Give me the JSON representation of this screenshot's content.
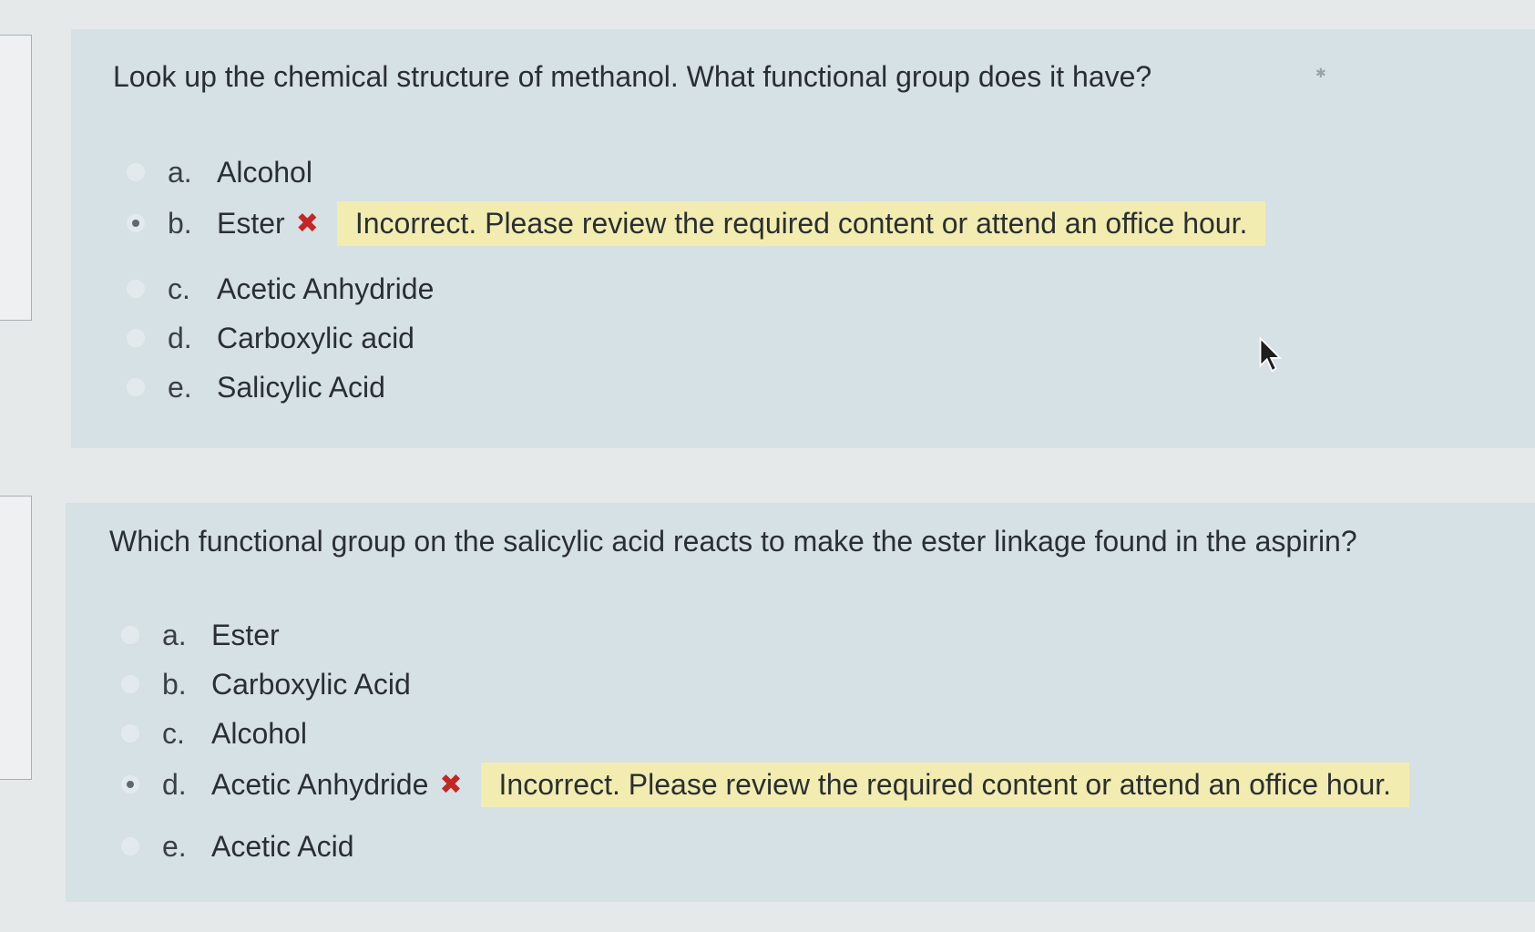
{
  "questions": [
    {
      "text": "Look up the chemical structure of methanol. What functional group does it have?",
      "options": [
        {
          "letter": "a.",
          "label": "Alcohol"
        },
        {
          "letter": "b.",
          "label": "Ester",
          "selected": true,
          "mark": "✖",
          "feedback": "Incorrect. Please review the required content or attend an office hour."
        },
        {
          "letter": "c.",
          "label": "Acetic Anhydride"
        },
        {
          "letter": "d.",
          "label": "Carboxylic acid"
        },
        {
          "letter": "e.",
          "label": "Salicylic Acid"
        }
      ]
    },
    {
      "text": "Which functional group on the salicylic acid reacts to make the ester linkage found in the aspirin?",
      "options": [
        {
          "letter": "a.",
          "label": "Ester"
        },
        {
          "letter": "b.",
          "label": "Carboxylic Acid"
        },
        {
          "letter": "c.",
          "label": "Alcohol"
        },
        {
          "letter": "d.",
          "label": "Acetic Anhydride",
          "selected": true,
          "mark": "✖",
          "feedback": "Incorrect. Please review the required content or attend an office hour."
        },
        {
          "letter": "e.",
          "label": "Acetic Acid"
        }
      ]
    }
  ],
  "colors": {
    "panel": "#d6e1e5",
    "feedback_bg": "#f3ecb0",
    "incorrect": "#c42626"
  },
  "icons": {
    "incorrect": "x-mark-icon",
    "pointer": "mouse-cursor-icon"
  }
}
